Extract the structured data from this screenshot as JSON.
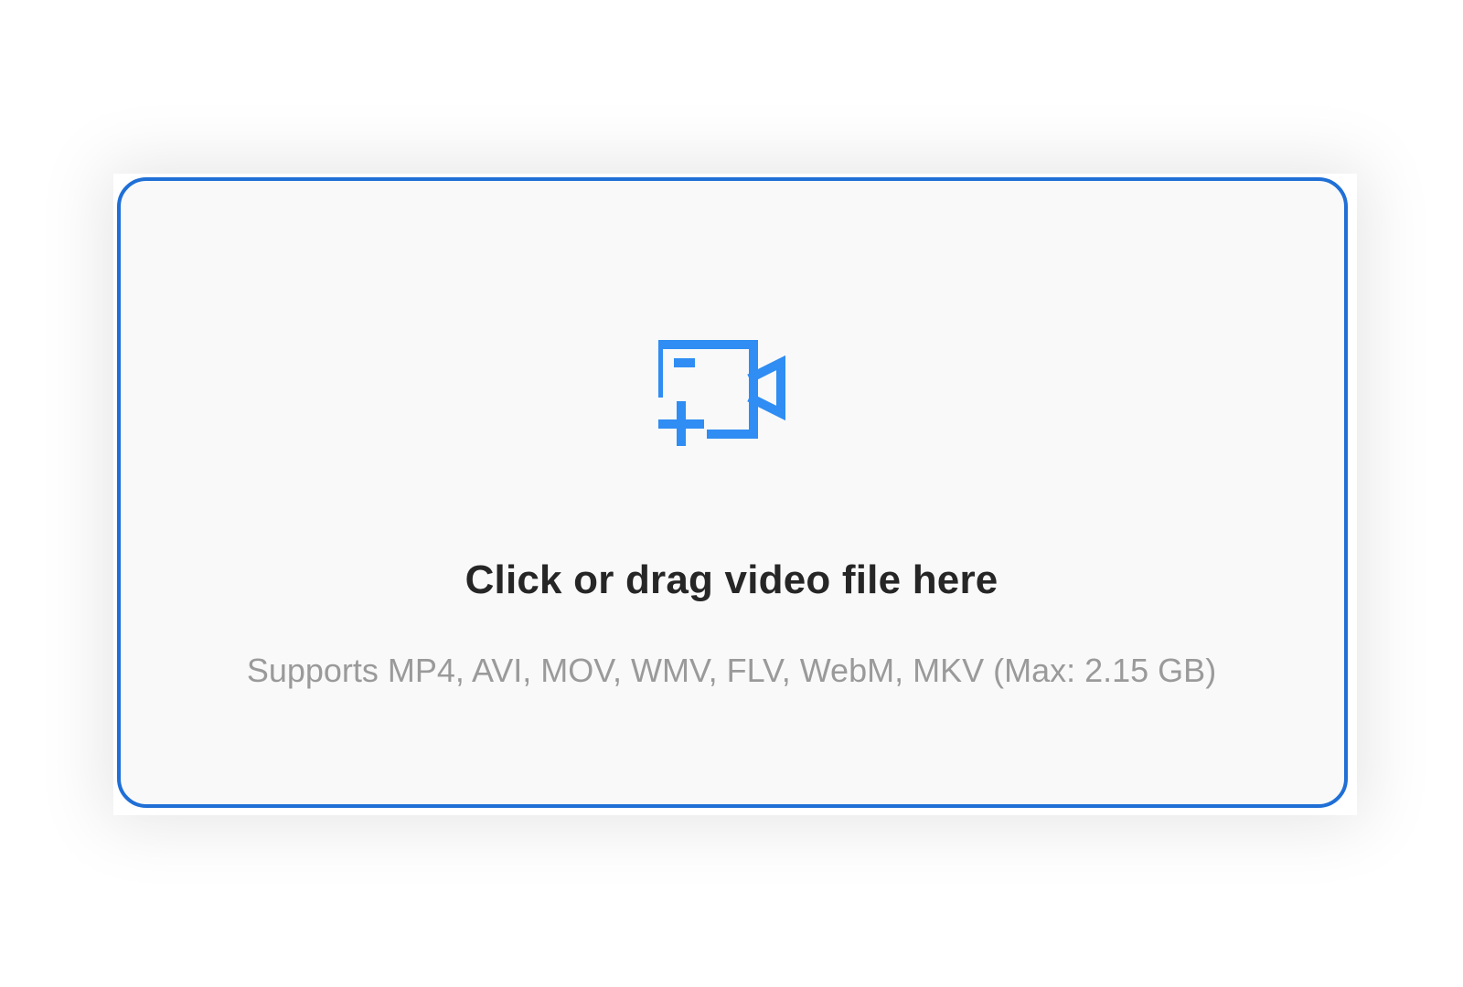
{
  "upload": {
    "icon": "video-add-icon",
    "title": "Click or drag video file here",
    "subtitle": "Supports MP4, AVI, MOV, WMV, FLV, WebM, MKV (Max: 2.15 GB)"
  },
  "colors": {
    "border": "#1f6fd6",
    "icon": "#2f8df3",
    "background": "#f9f9f9",
    "title": "#262626",
    "subtitle": "#9a9a9a"
  }
}
